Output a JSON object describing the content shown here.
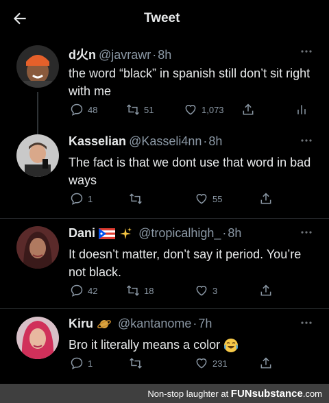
{
  "header": {
    "title": "Tweet"
  },
  "tweets": [
    {
      "name": "d火n",
      "handle": "@javrawr",
      "time": "8h",
      "text": "the word “black” in spanish still don’t sit right with me",
      "replies": "48",
      "retweets": "51",
      "likes": "1,073",
      "avatar_color": "#c8502a"
    },
    {
      "name": "Kasselian",
      "handle": "@Kasseli4nn",
      "time": "8h",
      "text": "The fact is that we dont use that word in bad ways",
      "replies": "1",
      "retweets": "",
      "likes": "55",
      "avatar_color": "#6b6f78"
    },
    {
      "name": "Dani",
      "handle": "@tropicalhigh_",
      "time": "8h",
      "text": "It doesn’t matter, don’t say it period. You’re not black.",
      "replies": "42",
      "retweets": "18",
      "likes": "3",
      "avatar_color": "#7a3b3b"
    },
    {
      "name": "Kiru",
      "handle": "@kantanome",
      "time": "7h",
      "text": "Bro it literally means a color",
      "replies": "1",
      "retweets": "",
      "likes": "231",
      "avatar_color": "#b03a5a"
    }
  ],
  "footer": {
    "prefix": "Non-stop laughter at ",
    "brand": "FUNsubstance",
    "suffix": ".com"
  },
  "colors": {
    "background": "#000000",
    "text": "#e7e9ea",
    "muted": "#8b98a5",
    "divider": "#2f3336"
  }
}
